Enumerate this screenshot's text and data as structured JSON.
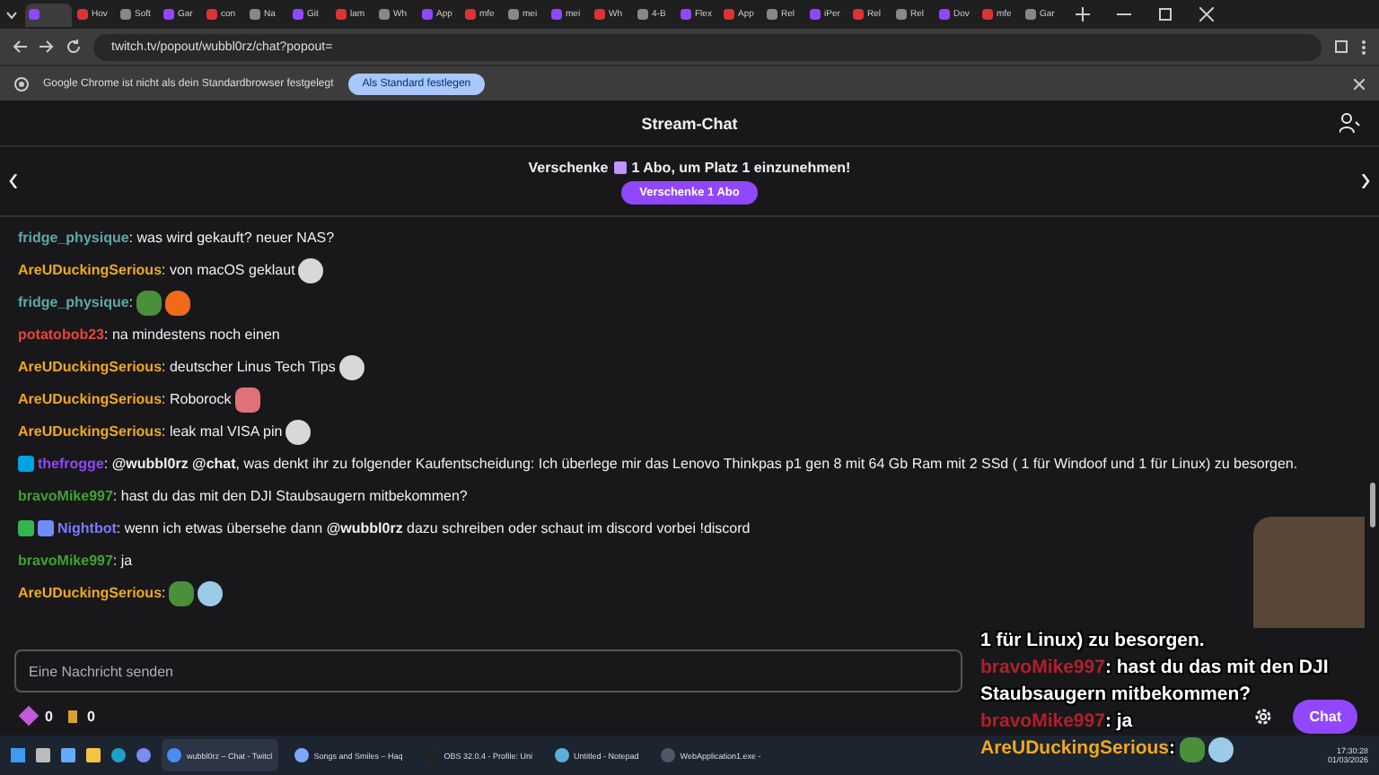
{
  "browser": {
    "tabs": [
      {
        "selected": true
      },
      {
        "title": "Hov",
        "selected": false
      },
      {
        "title": "Soft",
        "selected": false
      },
      {
        "title": "Gar",
        "selected": false
      },
      {
        "title": "con",
        "selected": false
      },
      {
        "title": "Na",
        "selected": false
      },
      {
        "title": "Git",
        "selected": false
      },
      {
        "title": "lam",
        "selected": false
      },
      {
        "title": "Wh",
        "selected": false
      },
      {
        "title": "App",
        "selected": false
      },
      {
        "title": "mfe",
        "selected": false
      },
      {
        "title": "mei",
        "selected": false
      },
      {
        "title": "mei",
        "selected": false
      },
      {
        "title": "Wh",
        "selected": false
      },
      {
        "title": "4-B",
        "selected": false
      },
      {
        "title": "Flex",
        "selected": false
      },
      {
        "title": "App",
        "selected": false
      },
      {
        "title": "Rel",
        "selected": false
      },
      {
        "title": "iPer",
        "selected": false
      },
      {
        "title": "Rel",
        "selected": false
      },
      {
        "title": "Rel",
        "selected": false
      },
      {
        "title": "Dov",
        "selected": false
      },
      {
        "title": "mfe",
        "selected": false
      },
      {
        "title": "Gar",
        "selected": false
      }
    ],
    "url": "twitch.tv/popout/wubbl0rz/chat?popout=",
    "infobar": {
      "message": "Google Chrome ist nicht als dein Standardbrowser festgelegt",
      "button": "Als Standard festlegen"
    }
  },
  "chat": {
    "title": "Stream-Chat",
    "banner": {
      "before": "Verschenke",
      "after": "1 Abo, um Platz 1 einzunehmen!",
      "button": "Verschenke 1 Abo"
    },
    "messages": [
      {
        "user": "fridge_physique",
        "color": "#5fa8a8",
        "text": ": was wird gekauft? neuer NAS?"
      },
      {
        "user": "AreUDuckingSerious",
        "color": "#f0a81c",
        "text": ": von macOS geklaut",
        "emotes": [
          {
            "kind": "face"
          }
        ]
      },
      {
        "user": "fridge_physique",
        "color": "#5fa8a8",
        "text": ":",
        "emotes": [
          {
            "kind": "frog"
          },
          {
            "kind": "fire"
          }
        ]
      },
      {
        "user": "potatobob23",
        "color": "#e8453c",
        "text": ": na mindestens noch einen"
      },
      {
        "user": "AreUDuckingSerious",
        "color": "#f0a81c",
        "text": ": deutscher Linus Tech Tips",
        "emotes": [
          {
            "kind": "face"
          }
        ]
      },
      {
        "user": "AreUDuckingSerious",
        "color": "#f0a81c",
        "text": ": Roborock",
        "emotes": [
          {
            "kind": "lips"
          }
        ]
      },
      {
        "user": "AreUDuckingSerious",
        "color": "#f0a81c",
        "text": ": leak mal VISA pin",
        "emotes": [
          {
            "kind": "face"
          }
        ]
      },
      {
        "user": "thefrogge",
        "color": "#9146ff",
        "badges": [
          {
            "kind": "crown"
          }
        ],
        "text": ": **@wubbl0rz** **@chat**, was denkt ihr zu folgender Kaufentscheidung: Ich überlege mir das Lenovo Thinkpas p1 gen 8 mit 64 Gb Ram mit 2 SSd ( 1 für Windoof und 1 für Linux) zu besorgen."
      },
      {
        "user": "bravoMike997",
        "color": "#3fa32f",
        "text": ": hast du das mit den DJI Staubsaugern mitbekommen?"
      },
      {
        "user": "Nightbot",
        "color": "#7b7bff",
        "badges": [
          {
            "kind": "robot"
          },
          {
            "kind": "cloud"
          }
        ],
        "text": ": wenn ich etwas übersehe dann **@wubbl0rz** dazu schreiben oder schaut im discord vorbei !discord"
      },
      {
        "user": "bravoMike997",
        "color": "#3fa32f",
        "text": ": ja"
      },
      {
        "user": "AreUDuckingSerious",
        "color": "#f0a81c",
        "text": ":",
        "emotes": [
          {
            "kind": "frog"
          },
          {
            "kind": "puff"
          }
        ]
      }
    ],
    "input": {
      "placeholder": "Eine Nachricht senden"
    },
    "bits": "0",
    "points": "0",
    "send_button": "Chat"
  },
  "overlay": {
    "lines": [
      {
        "text": "1 für Linux) zu besorgen."
      },
      {
        "user": "bravoMike997",
        "color": "#b0202a",
        "text": ": hast du das mit den DJI Staubsaugern mitbekommen?"
      },
      {
        "user": "bravoMike997",
        "color": "#b0202a",
        "text": ": ja"
      },
      {
        "user": "AreUDuckingSerious",
        "color": "#f0a81c",
        "text": ":",
        "emotes": [
          {
            "kind": "frog"
          },
          {
            "kind": "puff"
          }
        ]
      }
    ]
  },
  "taskbar": {
    "apps": [
      {
        "title": "wubbl0rz – Chat - Twitcl",
        "selected": true
      },
      {
        "title": "Songs and Smiles – Haq",
        "selected": false
      },
      {
        "title": "OBS 32.0.4 - Profile: Uni",
        "selected": false
      },
      {
        "title": "Untitled - Notepad",
        "selected": false
      },
      {
        "title": "WebApplication1.exe -",
        "selected": false
      }
    ],
    "time": "17:30:28",
    "date": "01/03/2026"
  }
}
